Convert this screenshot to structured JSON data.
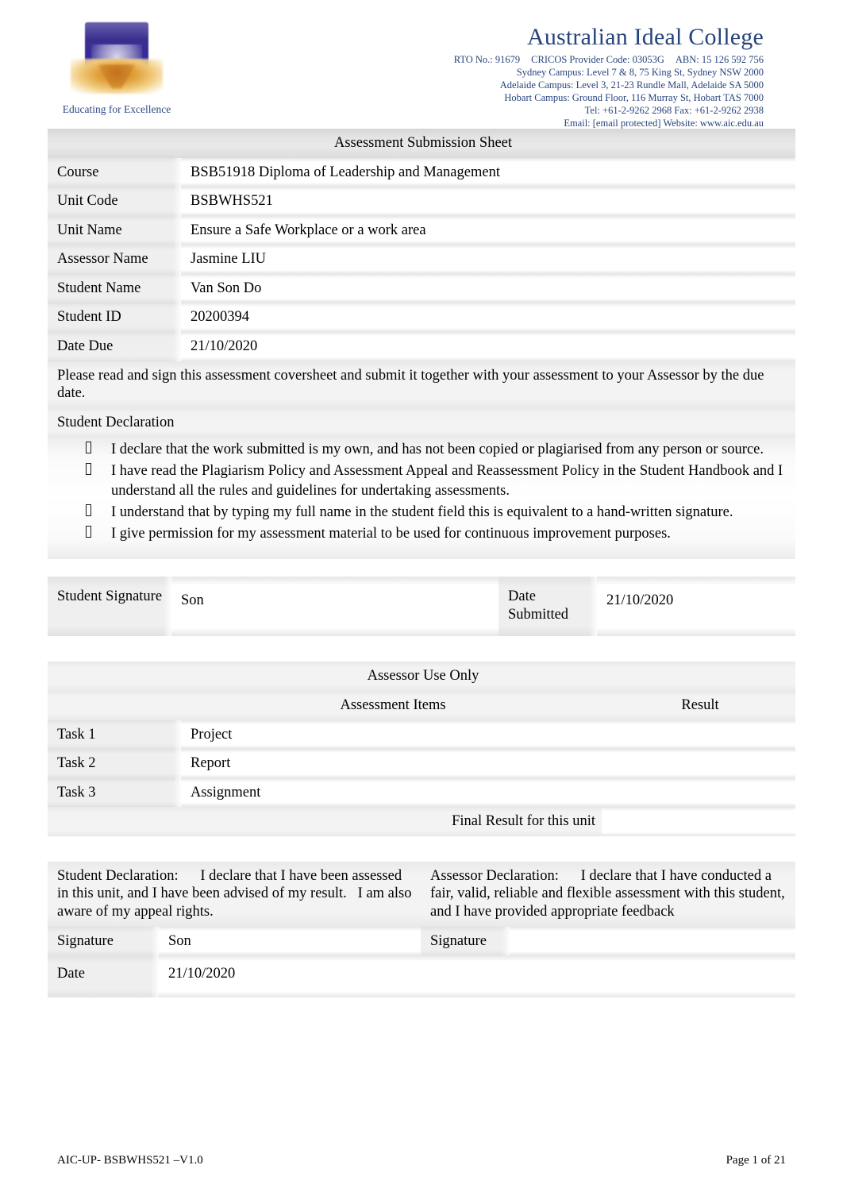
{
  "header": {
    "logo_tagline": "Educating for Excellence",
    "college_name": "Australian Ideal College",
    "rto": "RTO No.: 91679",
    "cricos": "CRICOS Provider Code: 03053G",
    "abn": "ABN: 15 126 592 756",
    "campus_sydney": "Sydney Campus: Level 7 & 8, 75 King St, Sydney NSW 2000",
    "campus_adelaide": "Adelaide Campus: Level 3, 21-23 Rundle Mall, Adelaide SA 5000",
    "campus_hobart": "Hobart Campus: Ground Floor, 116 Murray St, Hobart TAS 7000",
    "phone": "Tel: +61-2-9262 2968 Fax: +61-2-9262 2938",
    "email_web": "Email: [email protected] Website: www.aic.edu.au"
  },
  "sheet": {
    "title": "Assessment Submission Sheet",
    "fields": [
      {
        "label": "Course",
        "value": "BSB51918 Diploma of Leadership and Management"
      },
      {
        "label": "Unit Code",
        "value": "BSBWHS521"
      },
      {
        "label": "Unit Name",
        "value": "Ensure a Safe Workplace or a work area"
      },
      {
        "label": "Assessor Name",
        "value": "Jasmine LIU"
      },
      {
        "label": "Student Name",
        "value": "Van Son Do"
      },
      {
        "label": "Student ID",
        "value": "20200394"
      },
      {
        "label": "Date Due",
        "value": "21/10/2020"
      }
    ],
    "instruction": "Please read and sign this assessment coversheet and submit it together with your assessment to your Assessor by the due date.",
    "declaration_heading": "Student Declaration",
    "declaration_items": [
      "I declare that the work submitted is my own, and has not been copied or plagiarised from any person or source.",
      "I have read the Plagiarism Policy and Assessment Appeal and Reassessment Policy in the Student Handbook and I understand all the rules and guidelines for undertaking assessments.",
      "I understand that by typing my full name in the student field this is equivalent to a hand-written signature.",
      "I give permission for my assessment material to be used for continuous improvement purposes."
    ],
    "signature_row": {
      "student_signature_label": "Student Signature",
      "student_signature_value": "Son",
      "date_submitted_label": "Date Submitted",
      "date_submitted_value": "21/10/2020"
    }
  },
  "assessor": {
    "section_title": "Assessor Use Only",
    "col_items": "Assessment Items",
    "col_result": "Result",
    "rows": [
      {
        "task": "Task 1",
        "item": "Project",
        "result_a": "",
        "result_b": ""
      },
      {
        "task": "Task 2",
        "item": "Report",
        "result_a": "",
        "result_b": ""
      },
      {
        "task": "Task 3",
        "item": "Assignment",
        "result_a": "",
        "result_b": ""
      }
    ],
    "final_label": "Final Result for this unit",
    "final_result_a": "",
    "final_result_b": ""
  },
  "declarations": {
    "student_text": "Student Declaration:      I declare that I have been assessed in this unit, and I have been advised of my result.   I am also aware of my appeal rights.",
    "assessor_text": "Assessor Declaration:      I declare that I have conducted a fair, valid, reliable and flexible assessment with this student, and I have provided appropriate feedback",
    "student_signature_label": "Signature",
    "student_signature_value": "Son",
    "assessor_signature_label": "Signature",
    "assessor_signature_value": "",
    "date_label": "Date",
    "date_value": "21/10/2020",
    "assessor_date_value": ""
  },
  "footer": {
    "left": "AIC-UP- BSBWHS521 –V1.0",
    "right": "Page 1 of 21"
  },
  "colors": {
    "brand_blue": "#27447c",
    "logo_purple": "#3a2f8f",
    "logo_gold": "#d9821f",
    "cell_grey": "#efefef"
  }
}
